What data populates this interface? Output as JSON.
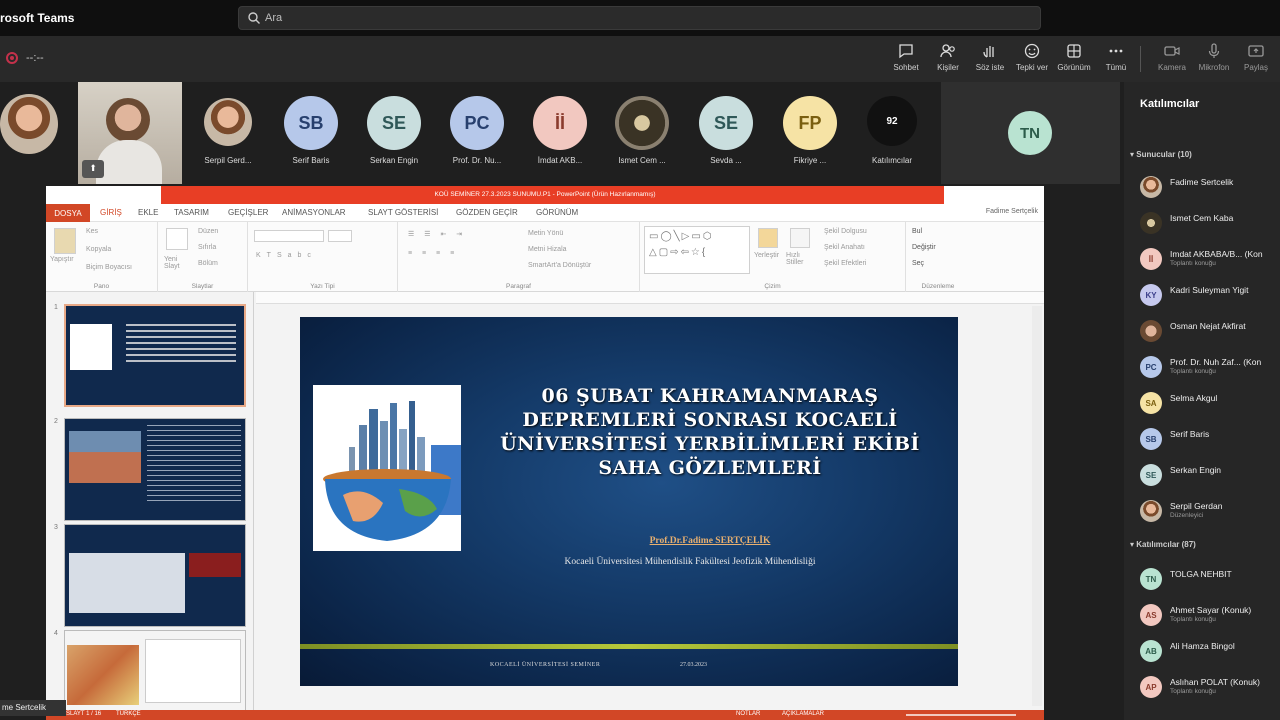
{
  "app": {
    "name": "rosoft Teams"
  },
  "search": {
    "placeholder": "Ara"
  },
  "meeting": {
    "timer": "--:--"
  },
  "toolbar": {
    "items": [
      {
        "label": "Sohbet",
        "icon": "chat-icon"
      },
      {
        "label": "Kişiler",
        "icon": "people-icon"
      },
      {
        "label": "Söz iste",
        "icon": "raise-hand-icon"
      },
      {
        "label": "Tepki ver",
        "icon": "react-icon"
      },
      {
        "label": "Görünüm",
        "icon": "view-icon"
      },
      {
        "label": "Tümü",
        "icon": "more-icon"
      },
      {
        "label": "Kamera",
        "icon": "camera-icon"
      },
      {
        "label": "Mikrofon",
        "icon": "mic-icon"
      },
      {
        "label": "Paylaş",
        "icon": "share-icon"
      }
    ]
  },
  "strip": {
    "participants": [
      {
        "name": "",
        "initials": ""
      },
      {
        "name": "",
        "initials": ""
      },
      {
        "name": "Serpil Gerd...",
        "initials": ""
      },
      {
        "name": "Serif Baris",
        "initials": "SB",
        "color": "#b6c8ea"
      },
      {
        "name": "Serkan Engin",
        "initials": "SE",
        "color": "#c9dede"
      },
      {
        "name": "Prof. Dr. Nu...",
        "initials": "PC",
        "color": "#b6c8ea"
      },
      {
        "name": "İmdat AKB...",
        "initials": "İİ",
        "color": "#f2c8c0"
      },
      {
        "name": "Ismet Cem ...",
        "initials": ""
      },
      {
        "name": "Sevda ...",
        "initials": "SE",
        "color": "#c9dede"
      },
      {
        "name": "Fikriye ...",
        "initials": "FP",
        "color": "#f6e3a5"
      },
      {
        "name": "Katılımcılar",
        "initials": "92",
        "color": "#111111"
      }
    ],
    "tile": {
      "initials": "TN"
    }
  },
  "panel": {
    "title": "Katılımcılar",
    "presenters_header": "Sunucular (10)",
    "presenters": [
      {
        "name": "Fadime Sertcelik",
        "sub": "",
        "initials": "",
        "color": "#e3b8a0"
      },
      {
        "name": "Ismet Cem Kaba",
        "sub": "",
        "initials": "",
        "color": "#8a8a7a"
      },
      {
        "name": "Imdat AKBABA/B... (Kon",
        "sub": "Toplantı konuğu",
        "initials": "İİ",
        "color": "#f2c8c0"
      },
      {
        "name": "Kadri Suleyman Yigit",
        "sub": "",
        "initials": "KY",
        "color": "#c6c9ee"
      },
      {
        "name": "Osman Nejat Akfirat",
        "sub": "",
        "initials": "",
        "color": "#c0a080"
      },
      {
        "name": "Prof. Dr. Nuh Zaf... (Kon",
        "sub": "Toplantı konuğu",
        "initials": "PC",
        "color": "#b6c8ea"
      },
      {
        "name": "Selma Akgul",
        "sub": "",
        "initials": "SA",
        "color": "#f6e3a5"
      },
      {
        "name": "Serif Baris",
        "sub": "",
        "initials": "SB",
        "color": "#b6c8ea"
      },
      {
        "name": "Serkan Engin",
        "sub": "",
        "initials": "SE",
        "color": "#c9dede"
      },
      {
        "name": "Serpil Gerdan",
        "sub": "Düzenleyici",
        "initials": "",
        "color": "#d8a080"
      }
    ],
    "attendees_header": "Katılımcılar (87)",
    "attendees": [
      {
        "name": "TOLGA NEHBIT",
        "sub": "",
        "initials": "TN",
        "color": "#b9e3d1"
      },
      {
        "name": "Ahmet Sayar (Konuk)",
        "sub": "Toplantı konuğu",
        "initials": "AS",
        "color": "#f2c8c0"
      },
      {
        "name": "Ali Hamza Bingol",
        "sub": "",
        "initials": "AB",
        "color": "#b9e3d1"
      },
      {
        "name": "Aslıhan POLAT (Konuk)",
        "sub": "Toplantı konuğu",
        "initials": "AP",
        "color": "#f2c8c0"
      }
    ]
  },
  "ppt": {
    "window_title": "KOÜ SEMİNER 27.3.2023 SUNUMU.P1 - PowerPoint (Ürün Hazırlanmamış)",
    "user": "Fadime Sertçelik",
    "tabs": [
      "DOSYA",
      "GİRİŞ",
      "EKLE",
      "TASARIM",
      "GEÇİŞLER",
      "ANİMASYONLAR",
      "SLAYT GÖSTERİSİ",
      "GÖZDEN GEÇİR",
      "GÖRÜNÜM"
    ],
    "ribbon_groups": [
      "Pano",
      "Slaytlar",
      "Yazı Tipi",
      "Paragraf",
      "Çizim",
      "Düzenleme"
    ],
    "ribbon": {
      "paste": "Yapıştır",
      "cut": "Kes",
      "copy": "Kopyala",
      "format_painter": "Biçim Boyacısı",
      "new_slide": "Yeni Slayt",
      "layout": "Düzen",
      "reset": "Sıfırla",
      "section": "Bölüm",
      "text_direction": "Metin Yönü",
      "align_text": "Metni Hizala",
      "smartart": "SmartArt'a Dönüştür",
      "arrange": "Yerleştir",
      "quick_styles": "Hızlı Stiller",
      "shape_fill": "Şekil Dolgusu",
      "shape_outline": "Şekil Anahatı",
      "shape_effects": "Şekil Efektleri",
      "find": "Bul",
      "replace": "Değiştir",
      "select": "Seç"
    },
    "status": {
      "slide": "SLAYT 1 / 16",
      "language": "TÜRKÇE",
      "notes": "NOTLAR",
      "comments": "AÇIKLAMALAR"
    }
  },
  "slide": {
    "title": "06 ŞUBAT KAHRAMANMARAŞ DEPREMLERİ SONRASI KOCAELİ ÜNİVERSİTESİ YERBİLİMLERİ EKİBİ SAHA GÖZLEMLERİ",
    "author": "Prof.Dr.Fadime SERTÇELİK",
    "affiliation": "Kocaeli Üniversitesi Mühendislik Fakültesi Jeofizik Mühendisliği",
    "footer_left": "KOCAELİ ÜNİVERSİTESİ SEMİNER",
    "footer_right": "27.03.2023"
  },
  "thumbs": {
    "numbers": [
      "1",
      "2",
      "3",
      "4"
    ]
  },
  "presenter": {
    "name": "me Sertcelik"
  }
}
